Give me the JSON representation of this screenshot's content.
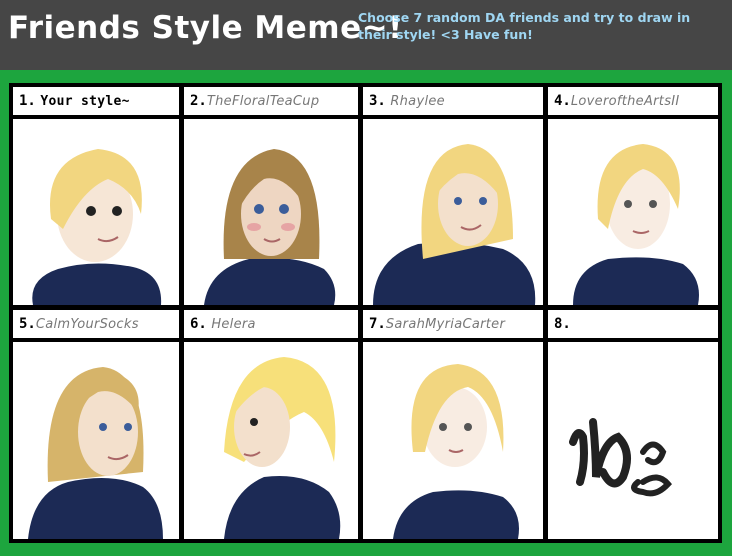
{
  "header": {
    "title": "Friends Style Meme~!",
    "subtitle": "Choose 7 random DA friends and try to draw in their style! <3 Have fun!"
  },
  "cells": [
    {
      "number": "1.",
      "name": "Your style~"
    },
    {
      "number": "2.",
      "name": "TheFloralTeaCup"
    },
    {
      "number": "3.",
      "name": "Rhaylee"
    },
    {
      "number": "4.",
      "name": "LoveroftheArtsII"
    },
    {
      "number": "5.",
      "name": "CalmYourSocks"
    },
    {
      "number": "6.",
      "name": "Helera"
    },
    {
      "number": "7.",
      "name": "SarahMyriaCarter"
    },
    {
      "number": "8.",
      "name": ""
    }
  ],
  "colors": {
    "background": "#1da53e",
    "header": "#464646",
    "hair_blonde": "#f2d680",
    "hair_brown": "#a8844a",
    "hoodie": "#1c2a55",
    "skin": "#f6e6d6"
  }
}
